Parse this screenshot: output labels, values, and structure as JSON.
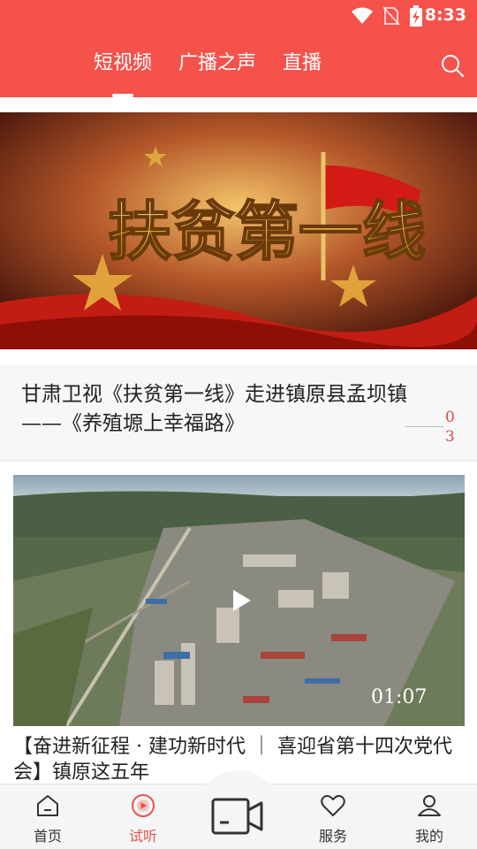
{
  "status_bar": {
    "time": "8:33",
    "icons": [
      "wifi-icon",
      "no-sim-icon",
      "battery-charging-icon"
    ]
  },
  "header": {
    "tabs": [
      {
        "label": "短视频",
        "active": true
      },
      {
        "label": "广播之声",
        "active": false
      },
      {
        "label": "直播",
        "active": false
      }
    ],
    "search_icon": "search-icon"
  },
  "banner": {
    "image_text": "扶贫第一线",
    "title": "甘肃卫视《扶贫第一线》走进镇原县孟坝镇——《养殖塬上幸福路》",
    "pager": {
      "current": "0",
      "total": "3"
    }
  },
  "video": {
    "duration": "01:07",
    "title": "【奋进新征程 · 建功新时代 ｜ 喜迎省第十四次党代会】镇原这五年"
  },
  "bottom_nav": {
    "items": [
      {
        "label": "首页",
        "icon": "home-icon",
        "active": false
      },
      {
        "label": "试听",
        "icon": "play-circle-icon",
        "active": true
      },
      {
        "label": "服务",
        "icon": "heart-icon",
        "active": false
      },
      {
        "label": "我的",
        "icon": "user-icon",
        "active": false
      }
    ],
    "center_icon": "video-camera-icon"
  },
  "colors": {
    "accent": "#f5524c",
    "active_nav": "#e9524c"
  }
}
